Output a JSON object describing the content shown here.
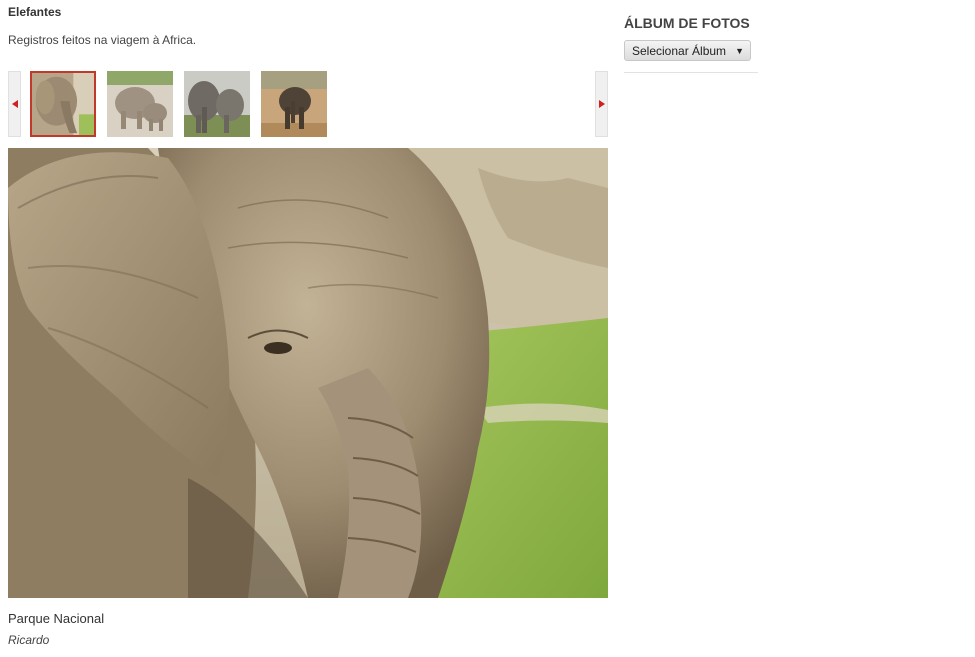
{
  "album": {
    "title": "Elefantes",
    "description": "Registros feitos na viagem à Africa."
  },
  "gallery": {
    "selected_index": 0,
    "thumbnails": [
      {
        "name": "thumb-elephant-closeup"
      },
      {
        "name": "thumb-elephant-mother-calf"
      },
      {
        "name": "thumb-elephant-herd"
      },
      {
        "name": "thumb-elephant-savanna"
      }
    ]
  },
  "photo": {
    "caption": "Parque Nacional",
    "author": "Ricardo"
  },
  "sidebar": {
    "title": "ÁLBUM DE FOTOS",
    "select_label": "Selecionar Álbum",
    "select_arrow": "▼"
  },
  "colors": {
    "accent_red": "#d02020",
    "selected_border": "#c0392b"
  }
}
